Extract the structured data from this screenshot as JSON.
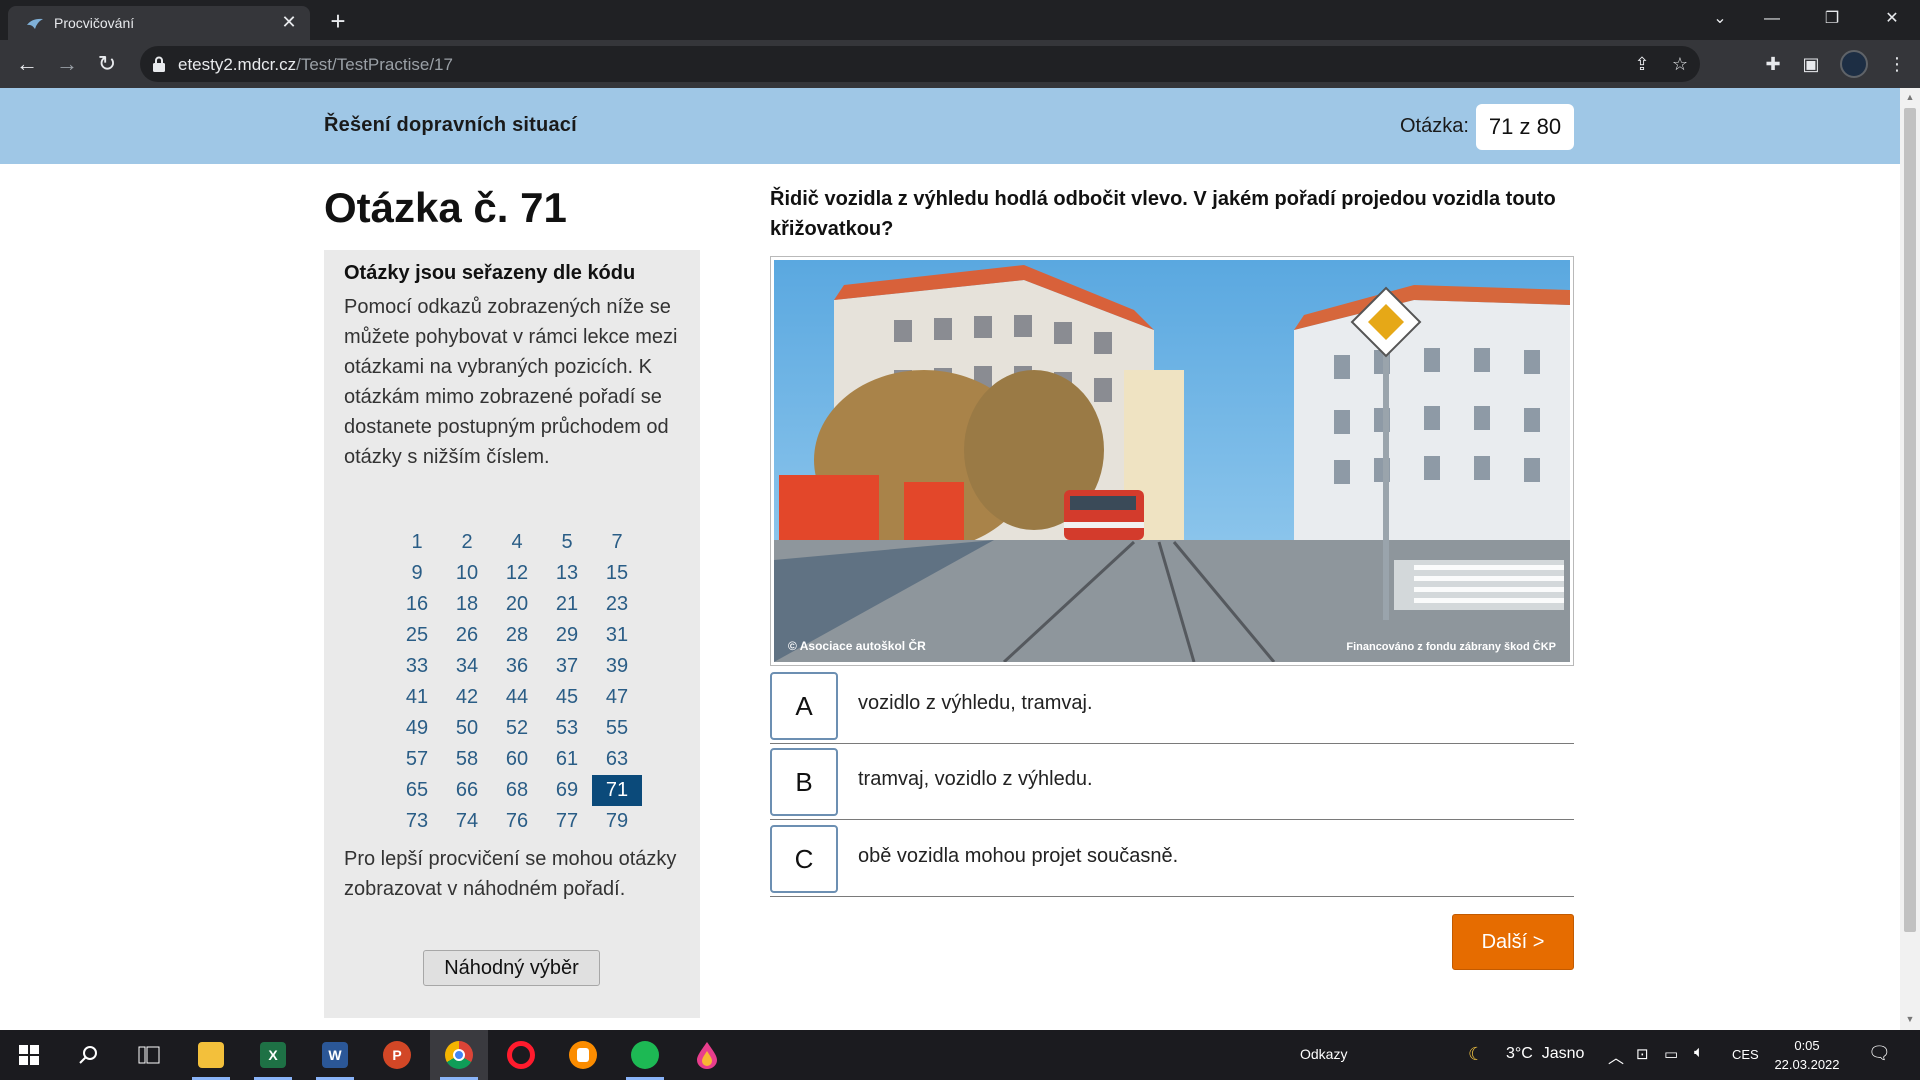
{
  "browser": {
    "tab_title": "Procvičování",
    "tab_close": "✕",
    "new_tab": "+",
    "url_domain": "etesty2.mdcr.cz",
    "url_path": "/Test/TestPractise/17",
    "icons": [
      "back-icon",
      "forward-icon",
      "reload-icon",
      "lock-icon",
      "share-icon",
      "star-icon",
      "extensions-icon",
      "sidepanel-icon",
      "profile-avatar",
      "menu-icon"
    ]
  },
  "banner": {
    "title": "Řešení dopravních situací",
    "question_label": "Otázka:",
    "question_counter": "71 z 80"
  },
  "heading": "Otázka č. 71",
  "sidebar": {
    "title": "Otázky jsou seřazeny dle kódu",
    "text": "Pomocí odkazů zobrazených níže se můžete pohybovat v rámci lekce mezi otázkami na vybraných pozicích. K otázkám mimo zobrazené pořadí se dostanete postupným průchodem od otázky s nižším číslem.",
    "numbers": [
      "1",
      "2",
      "4",
      "5",
      "7",
      "9",
      "10",
      "12",
      "13",
      "15",
      "16",
      "18",
      "20",
      "21",
      "23",
      "25",
      "26",
      "28",
      "29",
      "31",
      "33",
      "34",
      "36",
      "37",
      "39",
      "41",
      "42",
      "44",
      "45",
      "47",
      "49",
      "50",
      "52",
      "53",
      "55",
      "57",
      "58",
      "60",
      "61",
      "63",
      "65",
      "66",
      "68",
      "69",
      "71",
      "73",
      "74",
      "76",
      "77",
      "79"
    ],
    "active": "71",
    "random_text": "Pro lepší procvičení se mohou otázky zobrazovat v náhodném pořadí.",
    "random_button": "Náhodný výběr"
  },
  "question": {
    "text": "Řidič vozidla z výhledu hodlá odbočit vlevo. V jakém pořadí projedou vozidla touto křižovatkou?",
    "photo_caption_left": "© Asociace autoškol ČR",
    "photo_caption_right": "Financováno z fondu zábrany škod ČKP",
    "answers": [
      {
        "letter": "A",
        "text": "vozidlo z výhledu, tramvaj."
      },
      {
        "letter": "B",
        "text": "tramvaj, vozidlo z výhledu."
      },
      {
        "letter": "C",
        "text": "obě vozidla mohou projet současně."
      }
    ],
    "next_button": "Další >"
  },
  "taskbar": {
    "apps": [
      "windows-start-icon",
      "search-icon",
      "task-view-icon",
      "file-explorer-icon",
      "excel-icon",
      "word-icon",
      "powerpoint-icon",
      "chrome-icon",
      "opera-icon",
      "brave-icon",
      "spotify-icon",
      "drop-app-icon"
    ],
    "links_label": "Odkazy",
    "weather": "3°C  Jasno",
    "language": "CES",
    "time": "0:05",
    "date": "22.03.2022"
  },
  "colors": {
    "banner": "#9fc7e6",
    "link": "#2a5d86",
    "active_number": "#0b4a7a",
    "next_button": "#e66c00"
  }
}
